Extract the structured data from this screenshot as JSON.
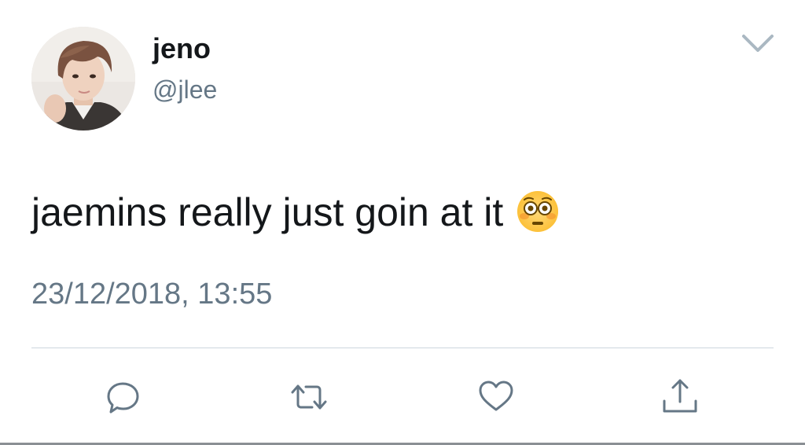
{
  "tweet": {
    "author": {
      "display_name": "jeno",
      "handle": "@jlee"
    },
    "text": "jaemins really just goin at it",
    "emoji": "flushed-face",
    "timestamp": "23/12/2018, 13:55"
  },
  "actions": [
    {
      "icon": "reply-icon"
    },
    {
      "icon": "retweet-icon"
    },
    {
      "icon": "like-icon"
    },
    {
      "icon": "share-icon"
    }
  ],
  "colors": {
    "text_primary": "#14171a",
    "text_secondary": "#657786",
    "icon": "#657786",
    "divider": "#ccd6dd",
    "chevron": "#aab8c2"
  }
}
